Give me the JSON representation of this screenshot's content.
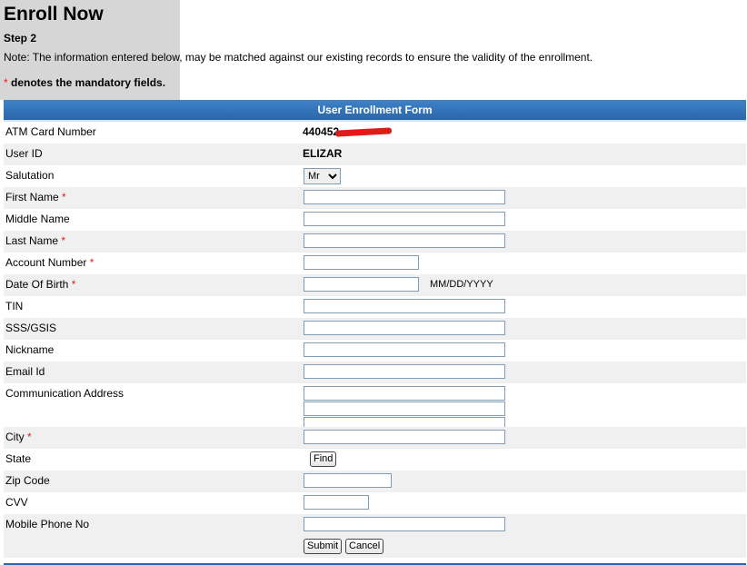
{
  "page": {
    "title": "Enroll Now",
    "step": "Step 2",
    "note": "Note: The information entered below, may be matched against our existing records to ensure the validity of the enrollment.",
    "mandatory_star": "*",
    "mandatory_text": " denotes the mandatory fields."
  },
  "form": {
    "header": "User Enrollment Form",
    "atm_label": "ATM Card Number",
    "atm_value": "440452",
    "userid_label": "User ID",
    "userid_value": "ELIZAR",
    "salutation_label": "Salutation",
    "salutation_value": "Mr",
    "firstname_label": "First Name",
    "middlename_label": "Middle Name",
    "lastname_label": "Last Name",
    "account_label": "Account Number",
    "dob_label": "Date Of Birth",
    "dob_hint": "MM/DD/YYYY",
    "tin_label": "TIN",
    "sss_label": "SSS/GSIS",
    "nickname_label": "Nickname",
    "email_label": "Email Id",
    "address_label": "Communication Address",
    "city_label": "City",
    "state_label": "State",
    "find_label": "Find",
    "zip_label": "Zip Code",
    "cvv_label": "CVV",
    "mobile_label": "Mobile Phone No",
    "submit_label": "Submit",
    "cancel_label": "Cancel",
    "required_star": "*"
  },
  "colors": {
    "header_blue": "#2a66aa",
    "required_red": "#e0201a",
    "row_alt": "#f0f0f0",
    "sidebar_gray": "#d6d6d6"
  }
}
